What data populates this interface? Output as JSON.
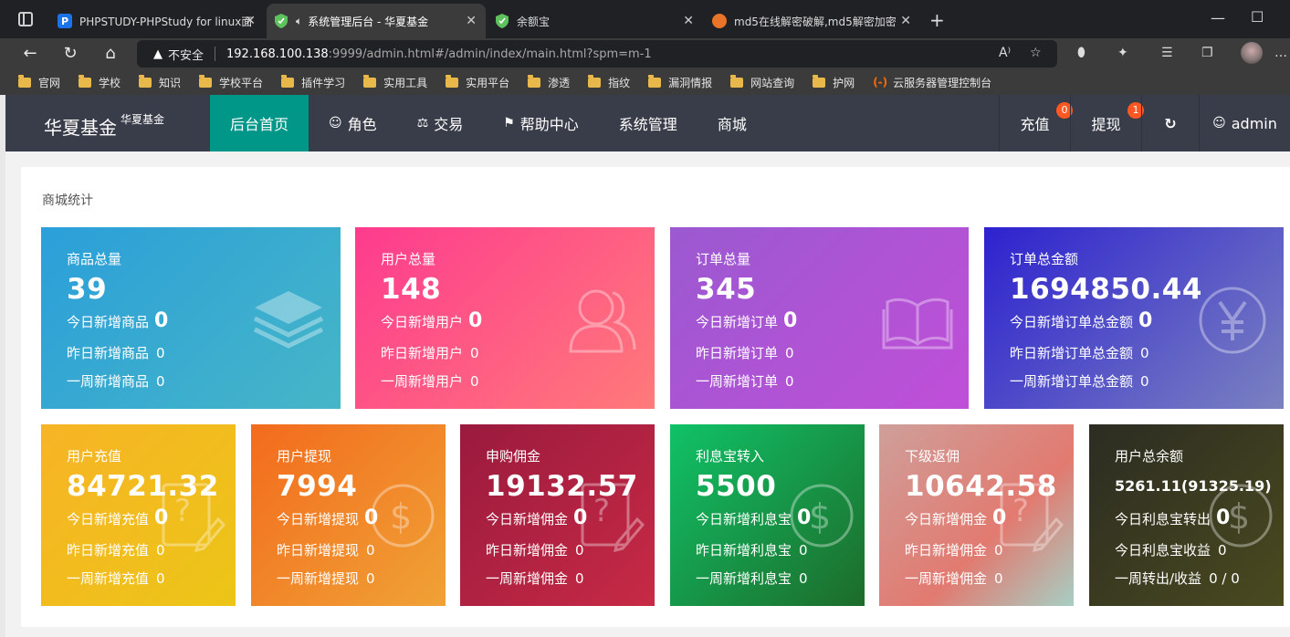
{
  "browser": {
    "tabs": [
      {
        "title": "PHPSTUDY-PHPStudy for linux面",
        "fav": "P"
      },
      {
        "title": "系统管理后台 - 华夏基金",
        "fav": ""
      },
      {
        "title": "余额宝",
        "fav": ""
      },
      {
        "title": "md5在线解密破解,md5解密加密",
        "fav": ""
      }
    ],
    "not_secure": "不安全",
    "url_host": "192.168.100.138",
    "url_rest": ":9999/admin.html#/admin/index/main.html?spm=m-1",
    "bookmarks": [
      "官网",
      "学校",
      "知识",
      "学校平台",
      "插件学习",
      "实用工具",
      "实用平台",
      "渗透",
      "指纹",
      "漏洞情报",
      "网站查询",
      "护网",
      "云服务器管理控制台"
    ]
  },
  "header": {
    "brand": "华夏基金",
    "brand_sup": "华夏基金",
    "nav": [
      "后台首页",
      "角色",
      "交易",
      "帮助中心",
      "系统管理",
      "商城"
    ],
    "recharge": "充值",
    "recharge_badge": "0",
    "withdraw": "提现",
    "withdraw_badge": "1",
    "user": "admin"
  },
  "panel": {
    "title": "商城统计",
    "top_cards": [
      {
        "label": "商品总量",
        "value": "39",
        "today_label": "今日新增商品",
        "today": "0",
        "yesterday_label": "昨日新增商品",
        "yesterday": "0",
        "week_label": "一周新增商品",
        "week": "0",
        "icon": "layers-icon"
      },
      {
        "label": "用户总量",
        "value": "148",
        "today_label": "今日新增用户",
        "today": "0",
        "yesterday_label": "昨日新增用户",
        "yesterday": "0",
        "week_label": "一周新增用户",
        "week": "0",
        "icon": "users-icon"
      },
      {
        "label": "订单总量",
        "value": "345",
        "today_label": "今日新增订单",
        "today": "0",
        "yesterday_label": "昨日新增订单",
        "yesterday": "0",
        "week_label": "一周新增订单",
        "week": "0",
        "icon": "book-icon"
      },
      {
        "label": "订单总金额",
        "value": "1694850.44",
        "today_label": "今日新增订单总金额",
        "today": "0",
        "yesterday_label": "昨日新增订单总金额",
        "yesterday": "0",
        "week_label": "一周新增订单总金额",
        "week": "0",
        "icon": "yen-icon"
      }
    ],
    "bottom_cards": [
      {
        "label": "用户充值",
        "value": "84721.32",
        "today_label": "今日新增充值",
        "today": "0",
        "yesterday_label": "昨日新增充值",
        "yesterday": "0",
        "week_label": "一周新增充值",
        "week": "0",
        "icon": "doc-edit-icon"
      },
      {
        "label": "用户提现",
        "value": "7994",
        "today_label": "今日新增提现",
        "today": "0",
        "yesterday_label": "昨日新增提现",
        "yesterday": "0",
        "week_label": "一周新增提现",
        "week": "0",
        "icon": "dollar-icon"
      },
      {
        "label": "申购佣金",
        "value": "19132.57",
        "today_label": "今日新增佣金",
        "today": "0",
        "yesterday_label": "昨日新增佣金",
        "yesterday": "0",
        "week_label": "一周新增佣金",
        "week": "0",
        "icon": "doc-edit-icon"
      },
      {
        "label": "利息宝转入",
        "value": "5500",
        "today_label": "今日新增利息宝",
        "today": "0",
        "yesterday_label": "昨日新增利息宝",
        "yesterday": "0",
        "week_label": "一周新增利息宝",
        "week": "0",
        "icon": "dollar-icon"
      },
      {
        "label": "下级返佣",
        "value": "10642.58",
        "today_label": "今日新增佣金",
        "today": "0",
        "yesterday_label": "昨日新增佣金",
        "yesterday": "0",
        "week_label": "一周新增佣金",
        "week": "0",
        "icon": "doc-edit-icon"
      },
      {
        "label": "用户总余额",
        "value": "5261.11(91325.19)",
        "today_label": "今日利息宝转出",
        "today": "0",
        "yesterday_label": "今日利息宝收益",
        "yesterday": "0",
        "week_label": "一周转出/收益",
        "week": "0 / 0",
        "icon": "dollar-icon"
      }
    ]
  }
}
